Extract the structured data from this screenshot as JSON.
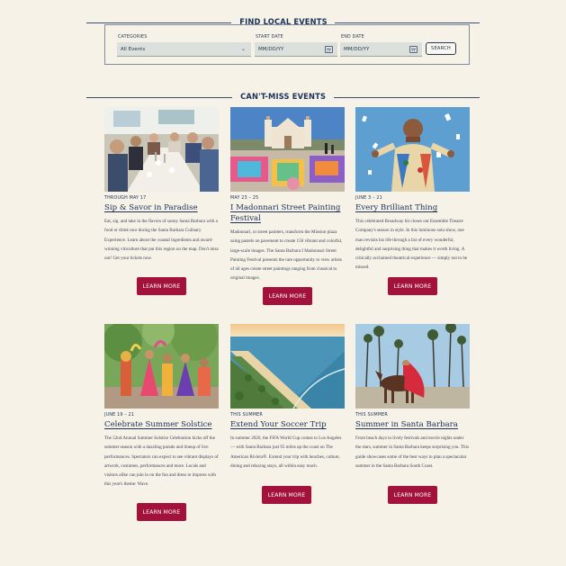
{
  "search": {
    "heading": "FIND LOCAL EVENTS",
    "categories_label": "CATEGORIES",
    "categories_value": "All Events",
    "start_label": "START DATE",
    "start_placeholder": "MM/DD/YY",
    "end_label": "END DATE",
    "end_placeholder": "MM/DD/YY",
    "button": "SEARCH"
  },
  "section": {
    "heading": "CAN'T-MISS EVENTS"
  },
  "cards": [
    {
      "date": "THROUGH MAY 17",
      "title": "Sip & Savor in Paradise",
      "desc": "Eat, sip, and take in the flavors of sunny Santa Barbara with a food or drink tour during the Santa Barbara Culinary Experience. Learn about the coastal ingredients and award-winning viticulture that put this region on the map. Don't miss out! Get your tickets now.",
      "button": "LEARN MORE"
    },
    {
      "date": "MAY 23 – 25",
      "title": "I Madonnari Street Painting Festival",
      "desc": "Madonnari, or street painters, transform the Mission plaza using pastels on pavement to create 150 vibrant and colorful, large-scale images. The Santa Barbara I Madonnari Street Painting Festival presents the rare opportunity to view artists of all ages create street paintings ranging from classical to original images.",
      "button": "LEARN MORE"
    },
    {
      "date": "JUNE 3 – 21",
      "title": "Every Brilliant Thing",
      "desc": "This celebrated Broadway hit closes out Ensemble Theatre Company's season in style. In this luminous solo show, one man revisits his life through a list of every wonderful, delightful and surprising thing that makes it worth living. A critically acclaimed theatrical experience — simply not to be missed.",
      "button": "LEARN MORE"
    },
    {
      "date": "JUNE 19 – 21",
      "title": "Celebrate Summer Solstice",
      "desc": "The 52nd Annual Summer Solstice Celebration kicks off the summer season with a dazzling parade and lineup of live performances. Spectators can expect to see vibrant displays of artwork, costumes, performances and more. Locals and visitors alike can join in on the fun and dress to impress with this year's theme: Wave.",
      "button": "LEARN MORE"
    },
    {
      "date": "THIS SUMMER",
      "title": "Extend Your Soccer Trip",
      "desc": "In summer 2026, the FIFA World Cup comes to Los Angeles — with Santa Barbara just 95 miles up the coast on The American Riviera®. Extend your trip with beaches, culture, dining and relaxing stays, all within easy reach.",
      "button": "LEARN MORE"
    },
    {
      "date": "THIS SUMMER",
      "title": "Summer in Santa Barbara",
      "desc": "From beach days to lively festivals and movie nights under the stars, summer in Santa Barbara keeps surprising you. This guide showcases some of the best ways to plan a spectacular summer in the Santa Barbara South Coast.",
      "button": "LEARN MORE"
    }
  ],
  "images": [
    "people-dining-photo",
    "mission-chalk-art-photo",
    "performer-confetti-photo",
    "solstice-parade-photo",
    "coastline-aerial-photo",
    "horse-rider-palms-photo"
  ],
  "colors": {
    "background": "#f6f2e7",
    "navy": "#1b3157",
    "button": "#a3123a",
    "field": "#dbe0dc"
  }
}
